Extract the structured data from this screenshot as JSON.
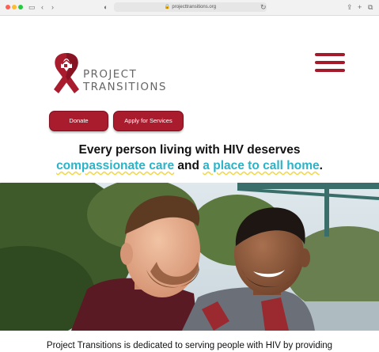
{
  "browser": {
    "url": "projecttransitions.org",
    "icons": [
      "back-icon",
      "forward-icon",
      "sidebar-icon",
      "share-icon",
      "new-tab-icon",
      "tabs-icon",
      "lock-icon",
      "privacy-icon",
      "reload-icon"
    ]
  },
  "header": {
    "logo_line1": "PROJECT",
    "logo_line2": "TRANSITIONS",
    "menu_icon": "hamburger-menu-icon"
  },
  "actions": {
    "donate_label": "Donate",
    "apply_label": "Apply for Services"
  },
  "hero": {
    "headline_line1": "Every person living with HIV deserves",
    "highlight1": "compassionate care",
    "connector": "and",
    "highlight2": "a place to call home",
    "period": "."
  },
  "intro": {
    "text": "Project Transitions is dedicated to serving people with HIV by providing"
  },
  "colors": {
    "brand": "#a81c2e",
    "highlight": "#2bb3c8",
    "underline": "#f2d84c"
  }
}
